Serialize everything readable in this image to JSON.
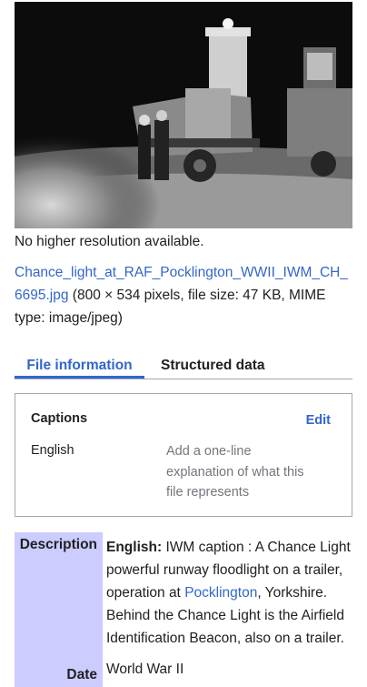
{
  "image": {
    "alt": "Black and white night photograph of two airmen standing beside the Chance Light floodlight trailer"
  },
  "no_higher_resolution": "No higher resolution available.",
  "file": {
    "name_line1": "Chance_light_at_RAF_Pocklington_WWII_IWM_CH_",
    "name_line2": "6695.jpg",
    "details_line2": " (800 × 534 pixels, file size: 47 KB, MIME",
    "details_line3": "type: image/jpeg)"
  },
  "tabs": [
    {
      "label": "File information",
      "active": true
    },
    {
      "label": "Structured data",
      "active": false
    }
  ],
  "captions": {
    "title": "Captions",
    "edit_label": "Edit",
    "language": "English",
    "placeholder_lines": [
      "Add a one-line",
      "explanation of what this",
      "file represents"
    ]
  },
  "description": {
    "header": "Description",
    "lang_label": "English:",
    "line1": " IWM caption : A Chance Light",
    "line2": "powerful runway floodlight on a trailer,",
    "line3_pre": "operation at ",
    "line3_link": "Pocklington",
    "line3_post": ", Yorkshire.",
    "line4": "Behind the Chance Light is the Airfield",
    "line5": "Identification Beacon, also on a trailer."
  },
  "date": {
    "header": "Date",
    "value": "World War II"
  },
  "colors": {
    "link": "#3366cc",
    "table_header_bg": "#ccccff",
    "border": "#a2a9b1"
  }
}
